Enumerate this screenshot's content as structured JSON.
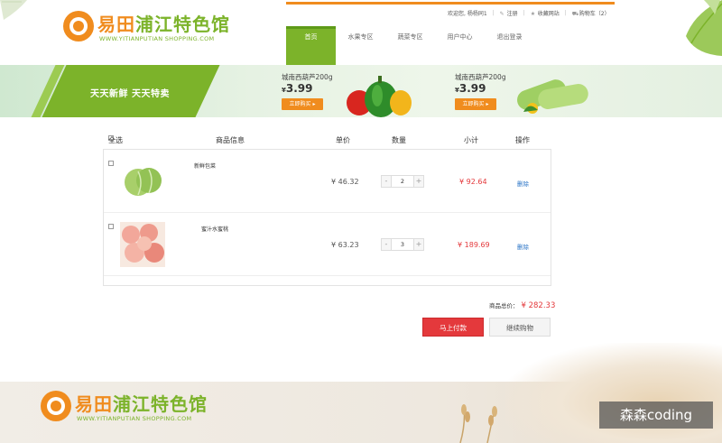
{
  "brand": {
    "name_orange": "易田",
    "name_green": "浦江特色馆",
    "url": "WWW.YITIANPUTIAN SHOPPING.COM"
  },
  "topbar": {
    "welcome": "欢迎您, 杨杨同1",
    "register": "注册",
    "favorite": "收藏网站",
    "cart": "购物车（2）"
  },
  "nav": [
    {
      "label": "首页",
      "active": true
    },
    {
      "label": "水果专区",
      "active": false
    },
    {
      "label": "蔬菜专区",
      "active": false
    },
    {
      "label": "用户中心",
      "active": false
    },
    {
      "label": "退出登录",
      "active": false
    }
  ],
  "banner": {
    "slogan": "天天新鲜  天天特卖",
    "promos": [
      {
        "name": "城南西葫芦200g",
        "currency": "¥",
        "price": "3.99",
        "button": "立即购买 ▸",
        "icon": "bell-pepper-image"
      },
      {
        "name": "城南西葫芦200g",
        "currency": "¥",
        "price": "3.99",
        "button": "立即购买 ▸",
        "icon": "zucchini-image"
      }
    ]
  },
  "cart": {
    "headers": {
      "select_all": "全选",
      "info": "商品信息",
      "unit_price": "单价",
      "quantity": "数量",
      "subtotal": "小计",
      "action": "操作"
    },
    "items": [
      {
        "name": "新鲜包菜",
        "price": "¥ 46.32",
        "qty": "2",
        "subtotal": "¥ 92.64",
        "delete": "删除",
        "icon": "cabbage-image"
      },
      {
        "name": "蜜汁水蜜桃",
        "price": "¥ 63.23",
        "qty": "3",
        "subtotal": "¥ 189.69",
        "delete": "删除",
        "icon": "peach-image"
      }
    ],
    "stepper_minus": "-",
    "stepper_plus": "+",
    "total_label": "商品总价：",
    "total_value": "¥ 282.33",
    "pay_button": "马上付款",
    "continue_button": "继续购物"
  },
  "watermark": "森森coding",
  "colors": {
    "brand_orange": "#f08c1e",
    "brand_green": "#7cb32a",
    "price_red": "#e4393c",
    "link_blue": "#2a74c6"
  }
}
